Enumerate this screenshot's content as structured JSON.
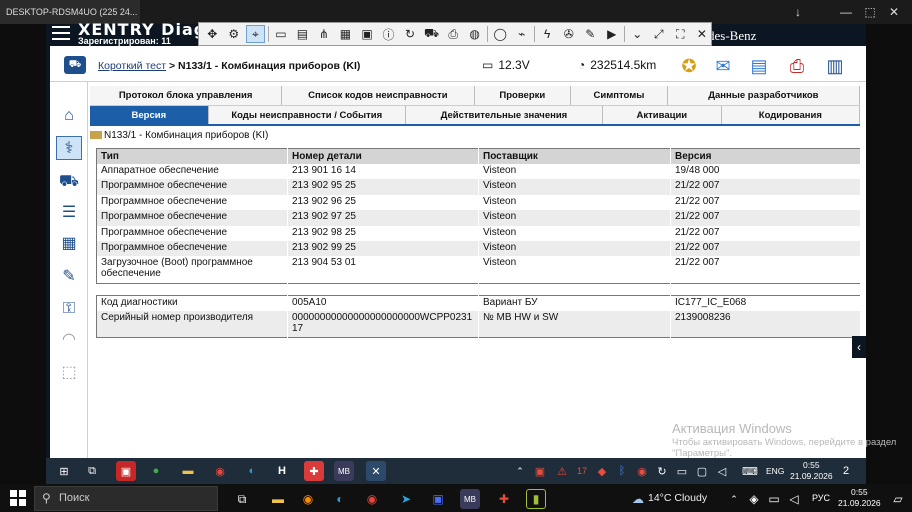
{
  "remote": {
    "tab_title": "DESKTOP-RDSM4UO (225 24...",
    "controls": [
      "↓",
      "—",
      "⬚",
      "✕"
    ]
  },
  "app": {
    "logo": "XENTRY Diagnos",
    "registered": "Зарегистрирован: 11",
    "brand": "des-Benz"
  },
  "toolbar": {
    "icons": [
      "move-icon",
      "gear-icon",
      "target-icon",
      "folder-icon",
      "file-icon",
      "network-icon",
      "calendar-icon",
      "image-icon",
      "info-icon",
      "sync-icon",
      "car-icon",
      "printer-icon",
      "sos-icon",
      "chat-icon",
      "plug-off-icon",
      "flash-icon",
      "wrench-icon",
      "pen-icon",
      "video-icon",
      "chevron-down-icon",
      "expand-icon",
      "fullscreen-icon",
      "close-icon"
    ]
  },
  "header": {
    "crumb_link": "Короткий тест",
    "crumb_sep": ">",
    "crumb_current": "N133/1 - Комбинация приборов (KI)",
    "voltage": "12.3V",
    "odometer": "232514.5km"
  },
  "tabs_row1": [
    "Протокол блока управления",
    "Список кодов неисправности",
    "Проверки",
    "Симптомы",
    "Данные разработчиков"
  ],
  "tabs_row2": [
    "Версия",
    "Коды неисправности / События",
    "Действительные значения",
    "Активации",
    "Кодирования"
  ],
  "section_title": "N133/1 - Комбинация приборов (KI)",
  "version_table": {
    "headers": [
      "Тип",
      "Номер детали",
      "Поставщик",
      "Версия"
    ],
    "rows": [
      [
        "Аппаратное обеспечение",
        "213 901 16 14",
        "Visteon",
        "19/48 000"
      ],
      [
        "Программное обеспечение",
        "213 902 95 25",
        "Visteon",
        "21/22 007"
      ],
      [
        "Программное обеспечение",
        "213 902 96 25",
        "Visteon",
        "21/22 007"
      ],
      [
        "Программное обеспечение",
        "213 902 97 25",
        "Visteon",
        "21/22 007"
      ],
      [
        "Программное обеспечение",
        "213 902 98 25",
        "Visteon",
        "21/22 007"
      ],
      [
        "Программное обеспечение",
        "213 902 99 25",
        "Visteon",
        "21/22 007"
      ],
      [
        "Загрузочное (Boot) программное обеспечение",
        "213 904 53 01",
        "Visteon",
        "21/22 007"
      ]
    ]
  },
  "diag_table": {
    "rows": [
      [
        "Код диагностики",
        "005A10",
        "Вариант БУ",
        "IC177_IC_E068"
      ],
      [
        "Серийный номер производителя",
        "00000000000000000000000WCPP023117",
        "№ MB HW и SW",
        "2139008236"
      ]
    ]
  },
  "watermark": {
    "title": "Активация Windows",
    "subtitle": "Чтобы активировать Windows, перейдите в раздел \"Параметры\"."
  },
  "inner_taskbar": {
    "lang": "ENG",
    "time": "0:55",
    "date": "21.09.2026",
    "notifications": "2"
  },
  "outer_taskbar": {
    "search_placeholder": "Поиск",
    "weather": "14°C  Cloudy",
    "lang": "РУС",
    "time": "0:55",
    "date": "21.09.2026"
  }
}
